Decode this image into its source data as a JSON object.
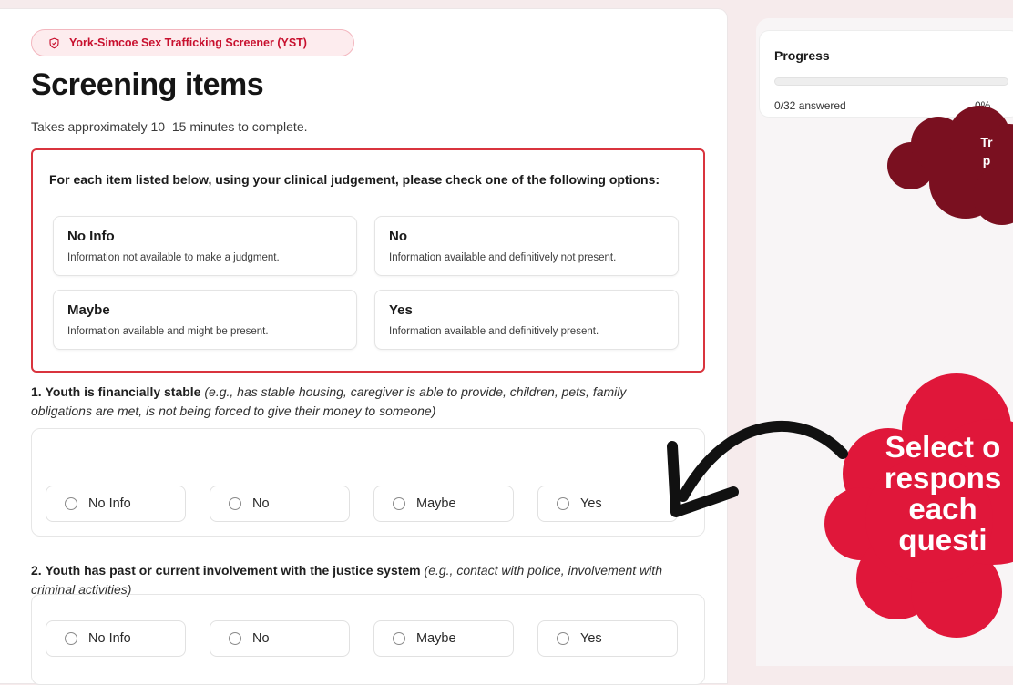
{
  "header": {
    "badge_label": "York-Simcoe Sex Trafficking Screener (YST)",
    "title": "Screening items",
    "subtitle": "Takes approximately 10–15 minutes to complete."
  },
  "legend": {
    "intro": "For each item listed below, using your clinical judgement, please check one of the following options:",
    "options": [
      {
        "title": "No Info",
        "desc": "Information not available to make a judgment."
      },
      {
        "title": "No",
        "desc": "Information available and definitively not present."
      },
      {
        "title": "Maybe",
        "desc": "Information available and might be present."
      },
      {
        "title": "Yes",
        "desc": "Information available and definitively present."
      }
    ]
  },
  "questions": [
    {
      "number": "1.",
      "bold": "Youth is financially stable",
      "italic": "(e.g., has stable housing, caregiver is able to provide, children, pets, family obligations are met, is not being forced to give their money to someone)"
    },
    {
      "number": "2.",
      "bold": "Youth has past or current involvement with the justice system",
      "italic": "(e.g., contact with police, involvement with criminal activities)"
    }
  ],
  "choices": [
    "No Info",
    "No",
    "Maybe",
    "Yes"
  ],
  "progress": {
    "title": "Progress",
    "count_text": "0/32 answered",
    "percent_text": "0%",
    "fraction": 0
  },
  "callouts": {
    "top": "Tr\np",
    "bottom": "Select o\nrespons\neach\nquesti"
  },
  "colors": {
    "accent": "#c8102e",
    "cloud_dark": "#7a1020",
    "cloud_red": "#e0173a",
    "background": "#f6ebec"
  }
}
